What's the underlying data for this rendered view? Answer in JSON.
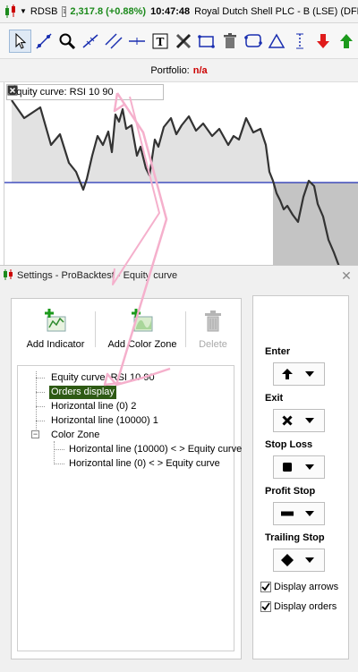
{
  "topbar": {
    "symbol": "RDSB",
    "info": "i",
    "price": "2,317.8 (+0.88%)",
    "time": "10:47:48",
    "instrument": "Royal Dutch Shell PLC - B (LSE) (DFB)"
  },
  "toolbar": {
    "icons": [
      "pointer-icon",
      "trendline-icon",
      "zoom-icon",
      "draw-line-icon",
      "parallel-line-icon",
      "horizontal-line-icon",
      "text-icon",
      "tools-icon",
      "rectangle-icon",
      "trash-icon",
      "loop-icon",
      "triangle-icon",
      "vertical-measure-icon",
      "sell-arrow-icon",
      "buy-arrow-icon"
    ]
  },
  "portfolio": {
    "label": "Portfolio:",
    "value": "n/a"
  },
  "chart": {
    "indicator_label": "Equity curve: RSI 10 90"
  },
  "settings": {
    "title": "Settings - ProBacktest - Equity curve",
    "buttons": {
      "add_indicator": "Add Indicator",
      "add_color_zone": "Add Color Zone",
      "delete": "Delete"
    },
    "tree": [
      "Equity curve: RSI 10 90",
      "Orders display",
      "Horizontal line (0) 2",
      "Horizontal line (10000) 1",
      "Color Zone",
      "Horizontal line (10000) < > Equity curve",
      "Horizontal line (0) < > Equity curve"
    ],
    "expander": "−",
    "orders": {
      "enter_label": "Enter",
      "exit_label": "Exit",
      "stop_loss_label": "Stop Loss",
      "profit_stop_label": "Profit Stop",
      "trailing_stop_label": "Trailing Stop",
      "display_arrows": "Display arrows",
      "display_orders": "Display orders",
      "display_arrows_checked": true,
      "display_orders_checked": true
    }
  },
  "colors": {
    "price_green": "#1c8a1c",
    "portfolio_red": "#cc0000",
    "selected_bg": "#2e5a14",
    "equity_line": "#333333",
    "reference_line": "#1f2fb4",
    "fill_above": "#e2e2e2",
    "fill_below": "#c4c4c4",
    "annotation_pink": "#f5b0cc"
  }
}
